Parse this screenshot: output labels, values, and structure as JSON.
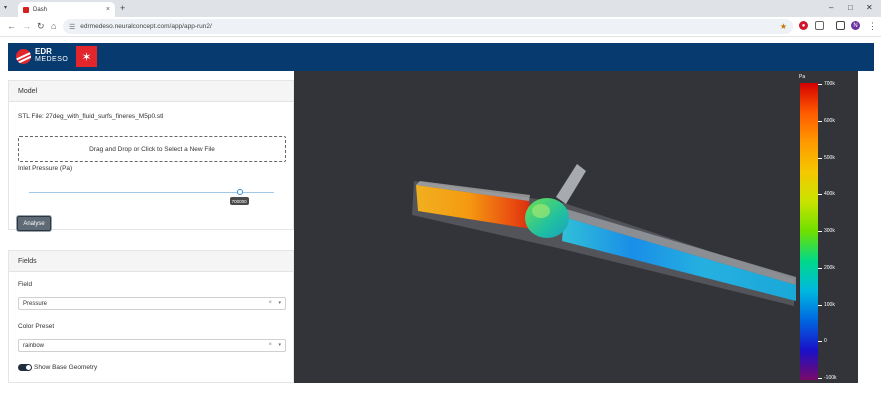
{
  "browser": {
    "tab_title": "Dash",
    "tab_close": "×",
    "tab_list": "▾",
    "new_tab": "+",
    "url": "edrmedeso.neuralconcept.com/app/app-run2/",
    "profile_initial": "N",
    "window_controls": {
      "minimize": "–",
      "maximize": "□",
      "close": "✕"
    }
  },
  "header": {
    "logo_line1": "EDR",
    "logo_line2": "MEDESO",
    "partner_logo": "✶"
  },
  "model_panel": {
    "title": "Model",
    "stl_file_label": "STL File: 27deg_with_fluid_surfs_fineres_M5p0.stl",
    "dropzone_text": "Drag and Drop or Click to Select a New File",
    "inlet_pressure_label": "Inlet Pressure (Pa)",
    "inlet_pressure_value": "700000",
    "inlet_pressure_fraction": 0.86,
    "analyse_button": "Analyse"
  },
  "fields_panel": {
    "title": "Fields",
    "field_label": "Field",
    "field_value": "Pressure",
    "color_preset_label": "Color Preset",
    "color_preset_value": "rainbow",
    "clear_symbol": "×",
    "dropdown_caret": "▾",
    "show_base_geometry_label": "Show Base Geometry",
    "show_base_geometry_on": true
  },
  "viewer": {
    "colorbar_unit": "Pa",
    "colorbar_ticks": [
      "700k",
      "600k",
      "500k",
      "400k",
      "300k",
      "200k",
      "100k",
      "0",
      "-100k"
    ],
    "colorbar_preset": "rainbow"
  },
  "colors": {
    "header_bg": "#073a6e",
    "accent_red": "#e2262b",
    "viewer_bg": "#323439"
  }
}
